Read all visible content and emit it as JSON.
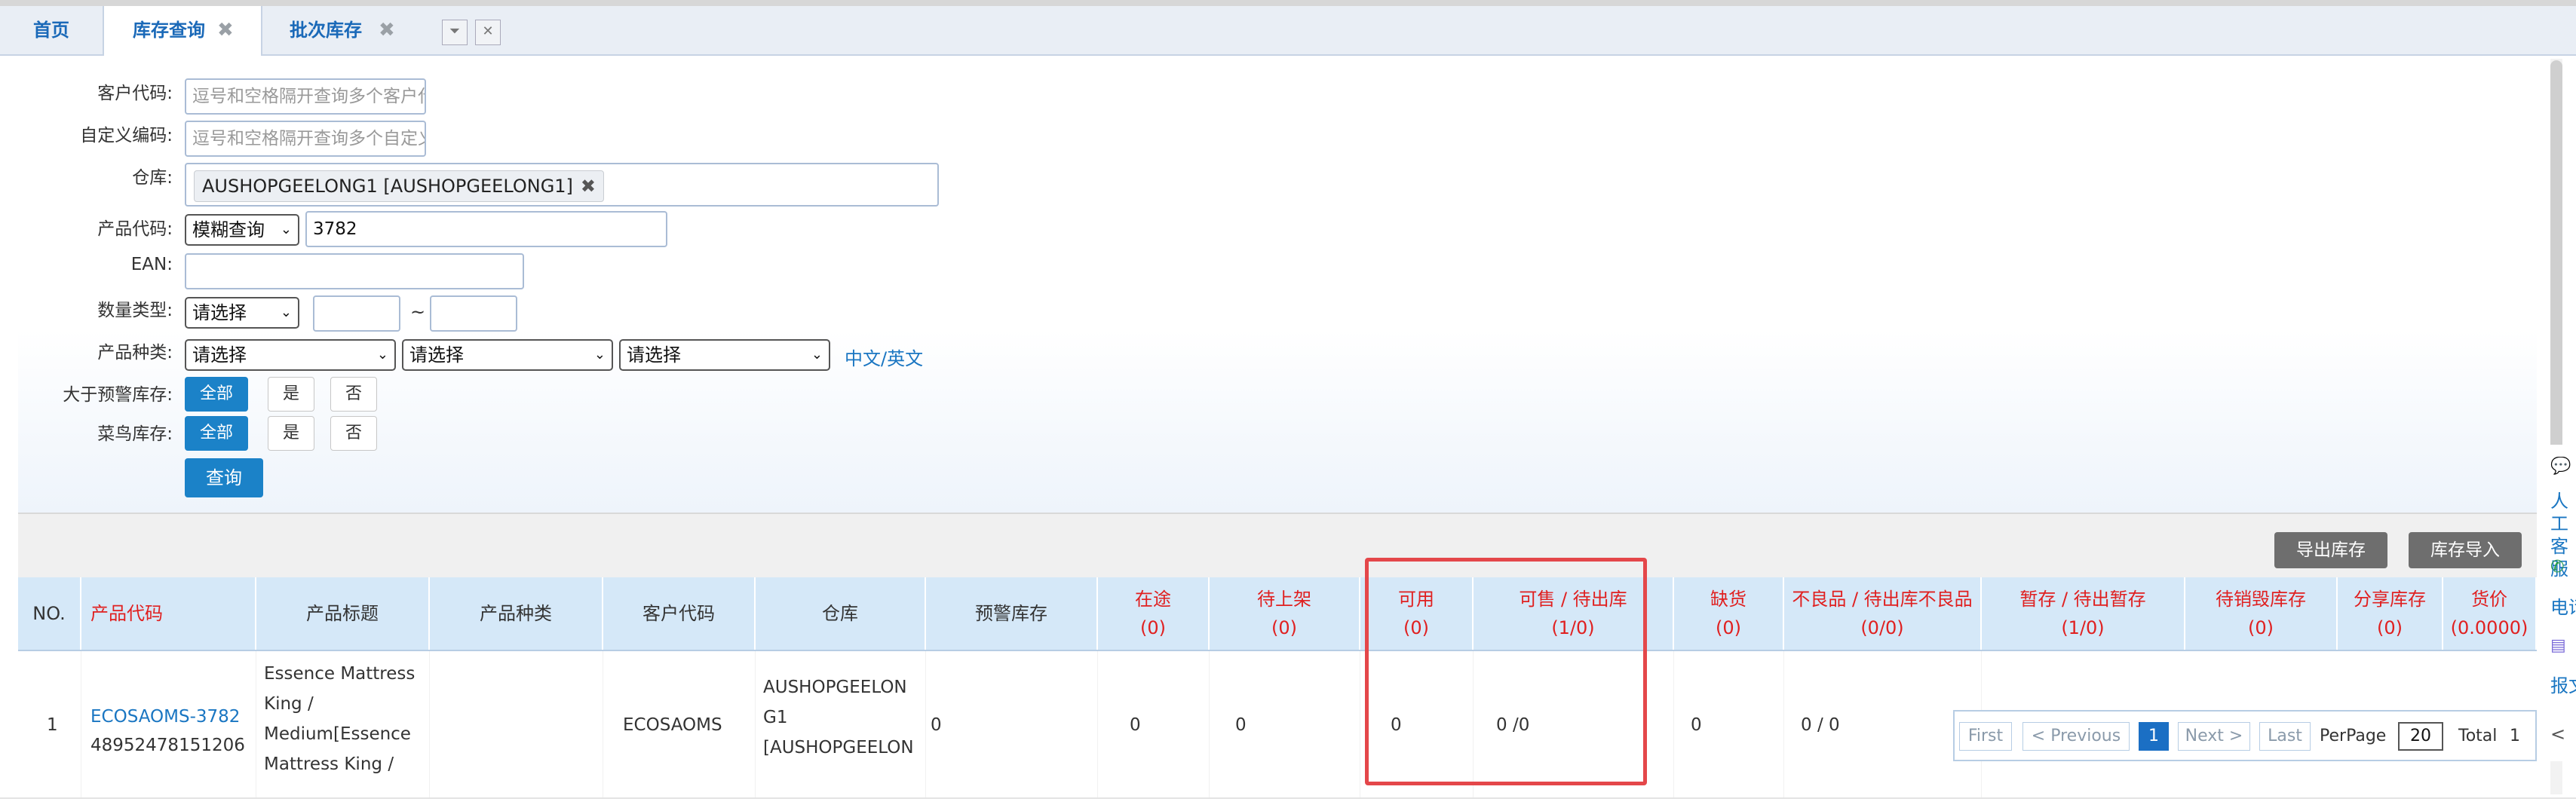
{
  "tabs": [
    {
      "label": "首页"
    },
    {
      "label": "库存查询",
      "close": "✖"
    },
    {
      "label": "批次库存",
      "close": "✖"
    }
  ],
  "tab_controls": {
    "dropdown": "⏷",
    "close": "✕"
  },
  "form": {
    "customer_code": {
      "label": "客户代码:",
      "placeholder": "逗号和空格隔开查询多个客户代码"
    },
    "custom_code": {
      "label": "自定义编码:",
      "placeholder": "逗号和空格隔开查询多个自定义编码"
    },
    "warehouse": {
      "label": "仓库:",
      "tag": "AUSHOPGEELONG1 [AUSHOPGEELONG1]",
      "tag_remove": "✖"
    },
    "product_code": {
      "label": "产品代码:",
      "mode": "模糊查询",
      "value": "3782"
    },
    "ean": {
      "label": "EAN:"
    },
    "qty_type": {
      "label": "数量类型:",
      "select": "请选择",
      "sep": "~"
    },
    "category": {
      "label": "产品种类:",
      "selects": [
        "请选择",
        "请选择",
        "请选择"
      ],
      "lang_link": "中文/英文"
    },
    "above_warning": {
      "label": "大于预警库存:",
      "options": [
        "全部",
        "是",
        "否"
      ]
    },
    "cainiao": {
      "label": "菜鸟库存:",
      "options": [
        "全部",
        "是",
        "否"
      ]
    },
    "query_button": "查询"
  },
  "toolbar": {
    "export": "导出库存",
    "import": "库存导入"
  },
  "grid": {
    "headers": [
      {
        "l1": "NO."
      },
      {
        "l1": "产品代码"
      },
      {
        "l1": "产品标题"
      },
      {
        "l1": "产品种类"
      },
      {
        "l1": "客户代码"
      },
      {
        "l1": "仓库"
      },
      {
        "l1": "预警库存"
      },
      {
        "l1": "在途",
        "l2": "(0)"
      },
      {
        "l1": "待上架",
        "l2": "(0)"
      },
      {
        "l1": "可用",
        "l2": "(0)"
      },
      {
        "l1": "可售 / 待出库",
        "l2": "(1/0)"
      },
      {
        "l1": "缺货",
        "l2": "(0)"
      },
      {
        "l1": "不良品 / 待出库不良品",
        "l2": "(0/0)"
      },
      {
        "l1": "暂存 / 待出暂存",
        "l2": "(1/0)"
      },
      {
        "l1": "待销毁库存",
        "l2": "(0)"
      },
      {
        "l1": "分享库存",
        "l2": "(0)"
      },
      {
        "l1": "货价",
        "l2": "(0.0000)"
      }
    ],
    "rows": [
      {
        "no": "1",
        "code": "ECOSAOMS-3782",
        "barcode": "48952478151206",
        "title_lines": [
          "Essence Mattress",
          "King /",
          "Medium[Essence",
          "Mattress King /"
        ],
        "category": "",
        "customer": "ECOSAOMS",
        "warehouse_lines": [
          "AUSHOPGEELON",
          "G1",
          "[AUSHOPGEELON"
        ],
        "warning": "0",
        "in_transit": "0",
        "pending_shelf": "0",
        "available": "0",
        "sellable": "0 /0",
        "shortage": "0",
        "defective": "0 / 0"
      }
    ]
  },
  "pager": {
    "first": "First",
    "prev": "< Previous",
    "current": "1",
    "next": "Next >",
    "last": "Last",
    "perpage_label": "PerPage",
    "perpage": "20",
    "total_label": "Total",
    "total": "1"
  },
  "side_panel": {
    "chat": "人工客服",
    "phone": "电话",
    "report": "报文"
  },
  "colors": {
    "accent": "#1b82c8",
    "header_bg": "#d5e8f8",
    "red": "#e02020",
    "highlight": "#e4474a"
  }
}
